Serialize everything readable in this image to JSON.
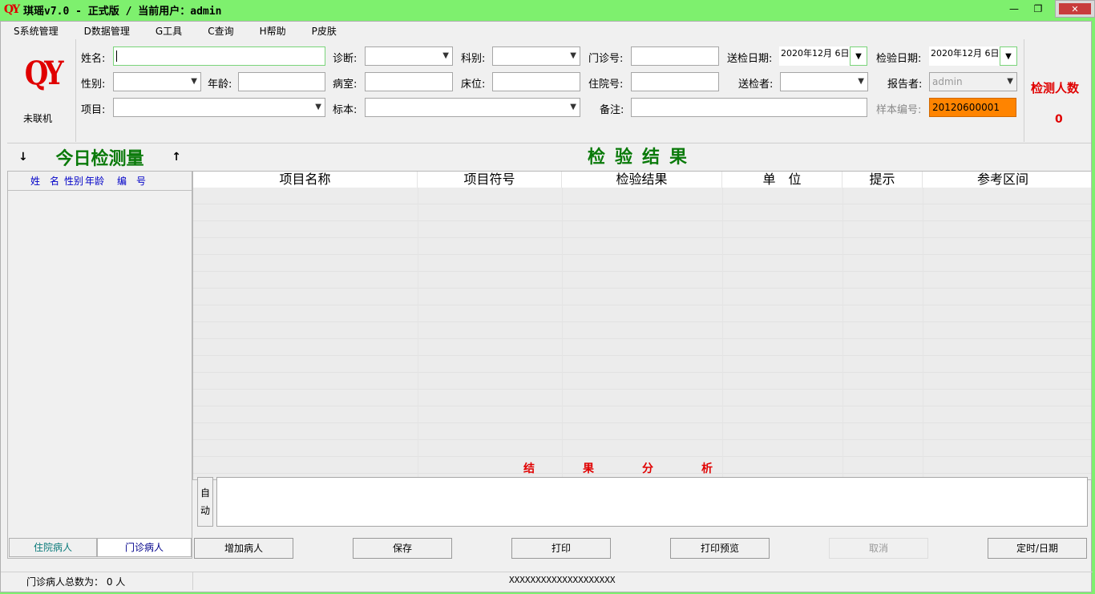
{
  "window": {
    "logo_text": "QY",
    "title": "琪瑶v7.0 - 正式版  /  当前用户：admin",
    "controls": {
      "minimize": "—",
      "restore": "❐",
      "close": "✕"
    }
  },
  "menu": [
    "S系统管理",
    "D数据管理",
    "G工具",
    "C查询",
    "H帮助",
    "P皮肤"
  ],
  "logo_box": {
    "logo": "QY",
    "status": "未联机"
  },
  "form": {
    "name_label": "姓名:",
    "name_value": "",
    "diagnosis_label": "诊断:",
    "diagnosis_value": "",
    "department_label": "科别:",
    "department_value": "",
    "outpatient_no_label": "门诊号:",
    "outpatient_no_value": "",
    "send_date_label": "送检日期:",
    "send_date_value": "2020年12月 6日",
    "test_date_label": "检验日期:",
    "test_date_value": "2020年12月 6日",
    "gender_label": "性别:",
    "gender_value": "",
    "age_label": "年龄:",
    "age_value": "",
    "ward_label": "病室:",
    "ward_value": "",
    "bed_label": "床位:",
    "bed_value": "",
    "inpatient_no_label": "住院号:",
    "inpatient_no_value": "",
    "sender_label": "送检者:",
    "sender_value": "",
    "reporter_label": "报告者:",
    "reporter_value": "admin",
    "item_label": "项目:",
    "item_value": "",
    "specimen_label": "标本:",
    "specimen_value": "",
    "remark_label": "备注:",
    "remark_value": "",
    "sample_no_label": "样本编号:",
    "sample_no_value": "20120600001"
  },
  "count": {
    "label": "检测人数",
    "value": "0"
  },
  "left_panel": {
    "title": "今日检测量",
    "arrow_down": "↓",
    "arrow_up": "↑",
    "columns": [
      "姓　名",
      "性别",
      "年龄",
      "编　号"
    ]
  },
  "results": {
    "title": "检验结果",
    "columns": [
      "项目名称",
      "项目符号",
      "检验结果",
      "单　位",
      "提示",
      "参考区间"
    ]
  },
  "analysis": {
    "title": "结果分析",
    "auto_button": "自动",
    "text": ""
  },
  "tabs": {
    "inpatient": "住院病人",
    "outpatient": "门诊病人"
  },
  "buttons": {
    "add_patient": "增加病人",
    "save": "保存",
    "print": "打印",
    "print_preview": "打印预览",
    "cancel": "取消",
    "timer_date": "定时/日期"
  },
  "status": {
    "left": "门诊病人总数为： 0 人",
    "center": "XXXXXXXXXXXXXXXXXXXX"
  },
  "colors": {
    "title_bar": "#7ef06e",
    "brand_red": "#e00000",
    "heading_green": "#0a7a0a",
    "sample_orange": "#ff8400"
  }
}
